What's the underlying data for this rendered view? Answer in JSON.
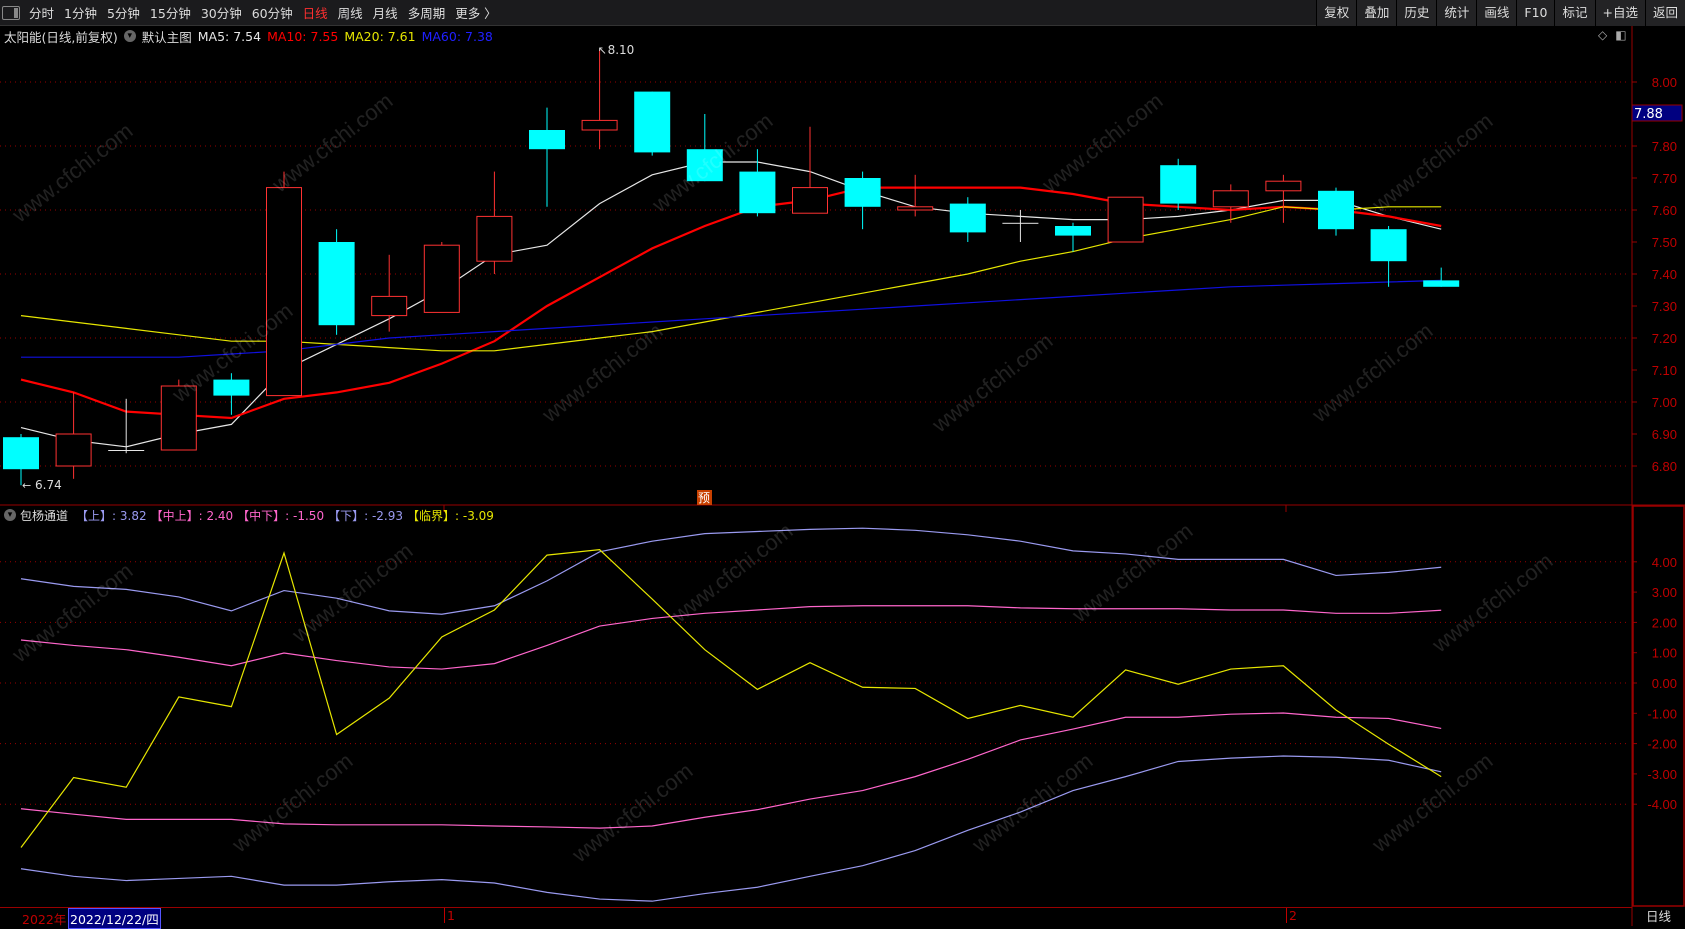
{
  "toolbar": {
    "periods": [
      "分时",
      "1分钟",
      "5分钟",
      "15分钟",
      "30分钟",
      "60分钟",
      "日线",
      "周线",
      "月线",
      "多周期",
      "更多 〉"
    ],
    "active_period": "日线",
    "buttons": [
      "复权",
      "叠加",
      "历史",
      "统计",
      "画线",
      "F10",
      "标记",
      "+自选",
      "返回"
    ]
  },
  "main_info": {
    "stock": "太阳能(日线,前复权)",
    "template": "默认主图",
    "ma5": "MA5: 7.54",
    "ma10": "MA10: 7.55",
    "ma20": "MA20: 7.61",
    "ma60": "MA60: 7.38"
  },
  "colors": {
    "up": "#ff3232",
    "down": "#00ffff",
    "ma5": "#e6e6e6",
    "ma10": "#ff0000",
    "ma20": "#e6e600",
    "ma60": "#1010e0",
    "axis": "#c00000",
    "upper": "#9a9af0",
    "mid": "#ff66cc",
    "crit": "#e6e600"
  },
  "watermark": "www.cfchi.com",
  "price_axis": {
    "ticks": [
      "8.00",
      "7.80",
      "7.70",
      "7.60",
      "7.50",
      "7.40",
      "7.30",
      "7.20",
      "7.10",
      "7.00",
      "6.90",
      "6.80"
    ],
    "current": "7.88"
  },
  "marks": {
    "high": "8.10",
    "low": "6.74",
    "forecast": "预"
  },
  "lower_info": {
    "name": "包杨通道",
    "upper": "【上】: 3.82",
    "mid_upper": "【中上】: 2.40",
    "mid_lower": "【中下】: -1.50",
    "lower": "【下】: -2.93",
    "critical": "【临界】: -3.09"
  },
  "lower_axis": {
    "ticks": [
      "4.00",
      "3.00",
      "2.00",
      "1.00",
      "0.00",
      "-1.00",
      "-2.00",
      "-3.00",
      "-4.00"
    ]
  },
  "date_axis": {
    "year": "2022年",
    "cursor_date": "2022/12/22/四",
    "months": [
      "1",
      "2"
    ],
    "period_label": "日线"
  },
  "chart_data": [
    {
      "type": "candlestick",
      "title": "太阳能(日线,前复权)",
      "ylim": [
        6.7,
        8.15
      ],
      "ohlc": [
        [
          6.89,
          6.9,
          6.74,
          6.79
        ],
        [
          6.8,
          7.03,
          6.76,
          6.9
        ],
        [
          6.85,
          7.01,
          6.84,
          6.85
        ],
        [
          6.85,
          7.07,
          6.85,
          7.05
        ],
        [
          7.07,
          7.09,
          6.96,
          7.02
        ],
        [
          7.02,
          7.72,
          7.02,
          7.67
        ],
        [
          7.5,
          7.54,
          7.21,
          7.24
        ],
        [
          7.27,
          7.46,
          7.22,
          7.33
        ],
        [
          7.28,
          7.5,
          7.28,
          7.49
        ],
        [
          7.44,
          7.72,
          7.4,
          7.58
        ],
        [
          7.85,
          7.92,
          7.61,
          7.79
        ],
        [
          7.85,
          8.1,
          7.79,
          7.88
        ],
        [
          7.97,
          7.97,
          7.77,
          7.78
        ],
        [
          7.79,
          7.9,
          7.69,
          7.69
        ],
        [
          7.72,
          7.79,
          7.58,
          7.59
        ],
        [
          7.59,
          7.86,
          7.59,
          7.67
        ],
        [
          7.7,
          7.72,
          7.54,
          7.61
        ],
        [
          7.6,
          7.71,
          7.58,
          7.61
        ],
        [
          7.62,
          7.64,
          7.5,
          7.53
        ],
        [
          7.56,
          7.6,
          7.5,
          7.56
        ],
        [
          7.55,
          7.56,
          7.47,
          7.52
        ],
        [
          7.5,
          7.64,
          7.5,
          7.64
        ],
        [
          7.74,
          7.76,
          7.6,
          7.62
        ],
        [
          7.61,
          7.68,
          7.56,
          7.66
        ],
        [
          7.66,
          7.71,
          7.56,
          7.69
        ],
        [
          7.66,
          7.67,
          7.52,
          7.54
        ],
        [
          7.54,
          7.55,
          7.36,
          7.44
        ],
        [
          7.38,
          7.42,
          7.36,
          7.36
        ]
      ],
      "series": [
        {
          "name": "MA5",
          "values": [
            6.92,
            6.88,
            6.86,
            6.9,
            6.93,
            7.1,
            7.18,
            7.26,
            7.35,
            7.46,
            7.49,
            7.62,
            7.71,
            7.75,
            7.75,
            7.72,
            7.66,
            7.61,
            7.59,
            7.58,
            7.57,
            7.57,
            7.58,
            7.6,
            7.63,
            7.63,
            7.58,
            7.54
          ]
        },
        {
          "name": "MA10",
          "values": [
            7.07,
            7.03,
            6.97,
            6.96,
            6.95,
            7.01,
            7.03,
            7.06,
            7.12,
            7.19,
            7.3,
            7.39,
            7.48,
            7.55,
            7.61,
            7.63,
            7.67,
            7.67,
            7.67,
            7.67,
            7.65,
            7.62,
            7.61,
            7.6,
            7.61,
            7.6,
            7.58,
            7.55
          ]
        },
        {
          "name": "MA20",
          "values": [
            7.27,
            7.25,
            7.23,
            7.21,
            7.19,
            7.19,
            7.18,
            7.17,
            7.16,
            7.16,
            7.18,
            7.2,
            7.22,
            7.25,
            7.28,
            7.31,
            7.34,
            7.37,
            7.4,
            7.44,
            7.47,
            7.51,
            7.54,
            7.57,
            7.61,
            7.6,
            7.61,
            7.61
          ]
        },
        {
          "name": "MA60",
          "values": [
            7.14,
            7.14,
            7.14,
            7.14,
            7.15,
            7.16,
            7.18,
            7.2,
            7.21,
            7.22,
            7.23,
            7.24,
            7.25,
            7.26,
            7.27,
            7.28,
            7.29,
            7.3,
            7.31,
            7.32,
            7.33,
            7.34,
            7.35,
            7.36,
            7.365,
            7.37,
            7.375,
            7.38
          ]
        }
      ]
    },
    {
      "type": "line",
      "title": "包杨通道",
      "ylim": [
        -7.4,
        5.4
      ],
      "series": [
        {
          "name": "上",
          "values": [
            3.44,
            3.19,
            3.09,
            2.84,
            2.38,
            3.05,
            2.8,
            2.38,
            2.27,
            2.55,
            3.37,
            4.33,
            4.68,
            4.93,
            5.0,
            5.07,
            5.11,
            5.04,
            4.89,
            4.68,
            4.36,
            4.26,
            4.08,
            4.08,
            4.08,
            3.55,
            3.65,
            3.82
          ]
        },
        {
          "name": "中上",
          "values": [
            1.42,
            1.24,
            1.1,
            0.85,
            0.57,
            0.99,
            0.74,
            0.53,
            0.46,
            0.64,
            1.24,
            1.88,
            2.13,
            2.3,
            2.41,
            2.52,
            2.55,
            2.55,
            2.55,
            2.48,
            2.45,
            2.45,
            2.45,
            2.41,
            2.41,
            2.3,
            2.3,
            2.4
          ]
        },
        {
          "name": "中下",
          "values": [
            -4.15,
            -4.33,
            -4.5,
            -4.5,
            -4.5,
            -4.65,
            -4.68,
            -4.68,
            -4.68,
            -4.72,
            -4.75,
            -4.79,
            -4.72,
            -4.43,
            -4.18,
            -3.83,
            -3.55,
            -3.09,
            -2.52,
            -1.88,
            -1.52,
            -1.13,
            -1.13,
            -1.03,
            -0.99,
            -1.13,
            -1.17,
            -1.5
          ]
        },
        {
          "name": "下",
          "values": [
            -6.13,
            -6.38,
            -6.52,
            -6.45,
            -6.38,
            -6.67,
            -6.67,
            -6.56,
            -6.49,
            -6.6,
            -6.91,
            -7.13,
            -7.2,
            -6.95,
            -6.74,
            -6.38,
            -6.03,
            -5.53,
            -4.86,
            -4.26,
            -3.55,
            -3.09,
            -2.59,
            -2.48,
            -2.41,
            -2.45,
            -2.55,
            -2.93
          ]
        },
        {
          "name": "临界",
          "values": [
            -5.43,
            -3.12,
            -3.44,
            -0.46,
            -0.78,
            4.29,
            -1.7,
            -0.5,
            1.52,
            2.41,
            4.22,
            4.4,
            2.77,
            1.1,
            -0.21,
            0.67,
            -0.14,
            -0.18,
            -1.17,
            -0.74,
            -1.13,
            0.43,
            -0.04,
            0.46,
            0.57,
            -0.89,
            -2.02,
            -3.09
          ]
        }
      ]
    }
  ]
}
